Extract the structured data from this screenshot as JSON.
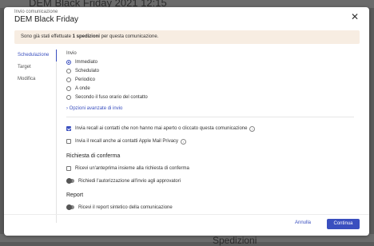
{
  "backdrop": {
    "title": "DEM Black Friday 2021 12:15",
    "bottom_text": "Spedizioni"
  },
  "modal": {
    "subtitle": "Invio comunicazione",
    "title": "DEM Black Friday",
    "info_prefix": "Sono già stati effettuate ",
    "info_bold": "1 spedizioni",
    "info_suffix": " per questa comunicazione."
  },
  "sidebar": {
    "items": [
      {
        "label": "Schedulazione",
        "active": true
      },
      {
        "label": "Target",
        "active": false
      },
      {
        "label": "Modifica",
        "active": false
      }
    ]
  },
  "schedule": {
    "label": "Invio",
    "options": [
      {
        "label": "Immediato",
        "checked": true
      },
      {
        "label": "Schedulato",
        "checked": false
      },
      {
        "label": "Periodico",
        "checked": false
      },
      {
        "label": "A onde",
        "checked": false
      },
      {
        "label": "Secondo il fuso orario del contatto",
        "checked": false
      }
    ],
    "advanced_link": "Opzioni avanzate di invio"
  },
  "recall": {
    "item1": "Invia recall ai contatti che non hanno mai aperto o cliccato questa comunicazione",
    "item1_checked": true,
    "item2": "Invia il recall anche ai contatti Apple Mail Privacy",
    "item2_checked": false
  },
  "confirmation": {
    "title": "Richiesta di conferma",
    "item1": "Ricevi un'anteprima insieme alla richiesta di conferma",
    "item2": "Richiedi l'autorizzazione all'invio agli approvatori"
  },
  "report": {
    "title": "Report",
    "item1": "Ricevi il report sintetico della comunicazione"
  },
  "footer": {
    "cancel_label": "Annulla",
    "continue_label": "Continua"
  },
  "colors": {
    "accent": "#3a4fbf",
    "banner": "#f7ede2"
  }
}
